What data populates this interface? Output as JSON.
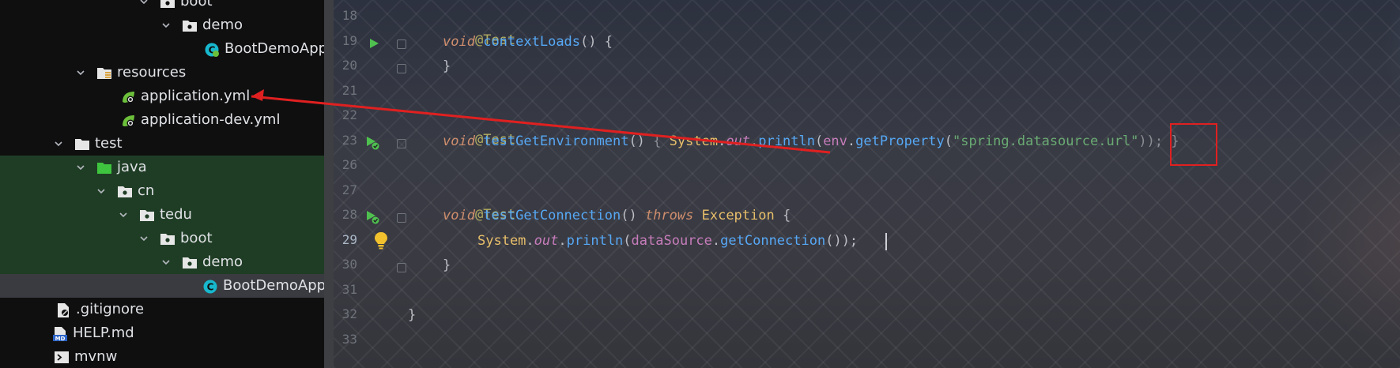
{
  "project_tree": {
    "items": [
      {
        "label": "boot",
        "icon": "package-folder-icon",
        "state": "normal"
      },
      {
        "label": "demo",
        "icon": "package-folder-icon",
        "state": "normal"
      },
      {
        "label": "BootDemoApp",
        "icon": "spring-class-icon",
        "state": "normal"
      },
      {
        "label": "resources",
        "icon": "resources-folder-icon",
        "state": "normal"
      },
      {
        "label": "application.yml",
        "icon": "spring-config-icon",
        "state": "normal"
      },
      {
        "label": "application-dev.yml",
        "icon": "spring-config-icon",
        "state": "normal"
      },
      {
        "label": "test",
        "icon": "folder-icon",
        "state": "normal"
      },
      {
        "label": "java",
        "icon": "test-source-folder-icon",
        "state": "green"
      },
      {
        "label": "cn",
        "icon": "package-folder-icon",
        "state": "green"
      },
      {
        "label": "tedu",
        "icon": "package-folder-icon",
        "state": "green"
      },
      {
        "label": "boot",
        "icon": "package-folder-icon",
        "state": "green"
      },
      {
        "label": "demo",
        "icon": "package-folder-icon",
        "state": "green"
      },
      {
        "label": "BootDemoApp",
        "icon": "class-icon",
        "state": "selected"
      },
      {
        "label": ".gitignore",
        "icon": "gitignore-icon",
        "state": "normal"
      },
      {
        "label": "HELP.md",
        "icon": "markdown-icon",
        "state": "normal"
      },
      {
        "label": "mvnw",
        "icon": "terminal-icon",
        "state": "normal"
      }
    ]
  },
  "editor": {
    "line_numbers": [
      "18",
      "19",
      "20",
      "21",
      "22",
      "23",
      "26",
      "27",
      "28",
      "29",
      "30",
      "31",
      "32",
      "33"
    ],
    "current_line": "29",
    "tokens": {
      "test_annotation": "@Test",
      "void": "void",
      "context_loads": "contextLoads",
      "empty_parens": "()",
      "brace_open": " {",
      "brace_close": "}",
      "test_get_environment": "testGetEnvironment",
      "inline_open": " { ",
      "system": "System",
      "dot": ".",
      "out": "out",
      "println": "println",
      "paren_open": "(",
      "env": "env",
      "get_property": "getProperty",
      "datasource_url": "\"spring.datasource.url\"",
      "close_inline": ")); }",
      "test_get_connection": "testGetConnection",
      "throws": "throws",
      "exception": "Exception",
      "data_source": "dataSource",
      "get_connection": "getConnection",
      "close_stmt": "());"
    }
  },
  "colors": {
    "annotation": "#b3ae60",
    "keyword": "#cf8e6d",
    "method": "#56a8f5",
    "string": "#6aab73",
    "highlight_box": "#e02020",
    "arrow": "#e02020"
  }
}
